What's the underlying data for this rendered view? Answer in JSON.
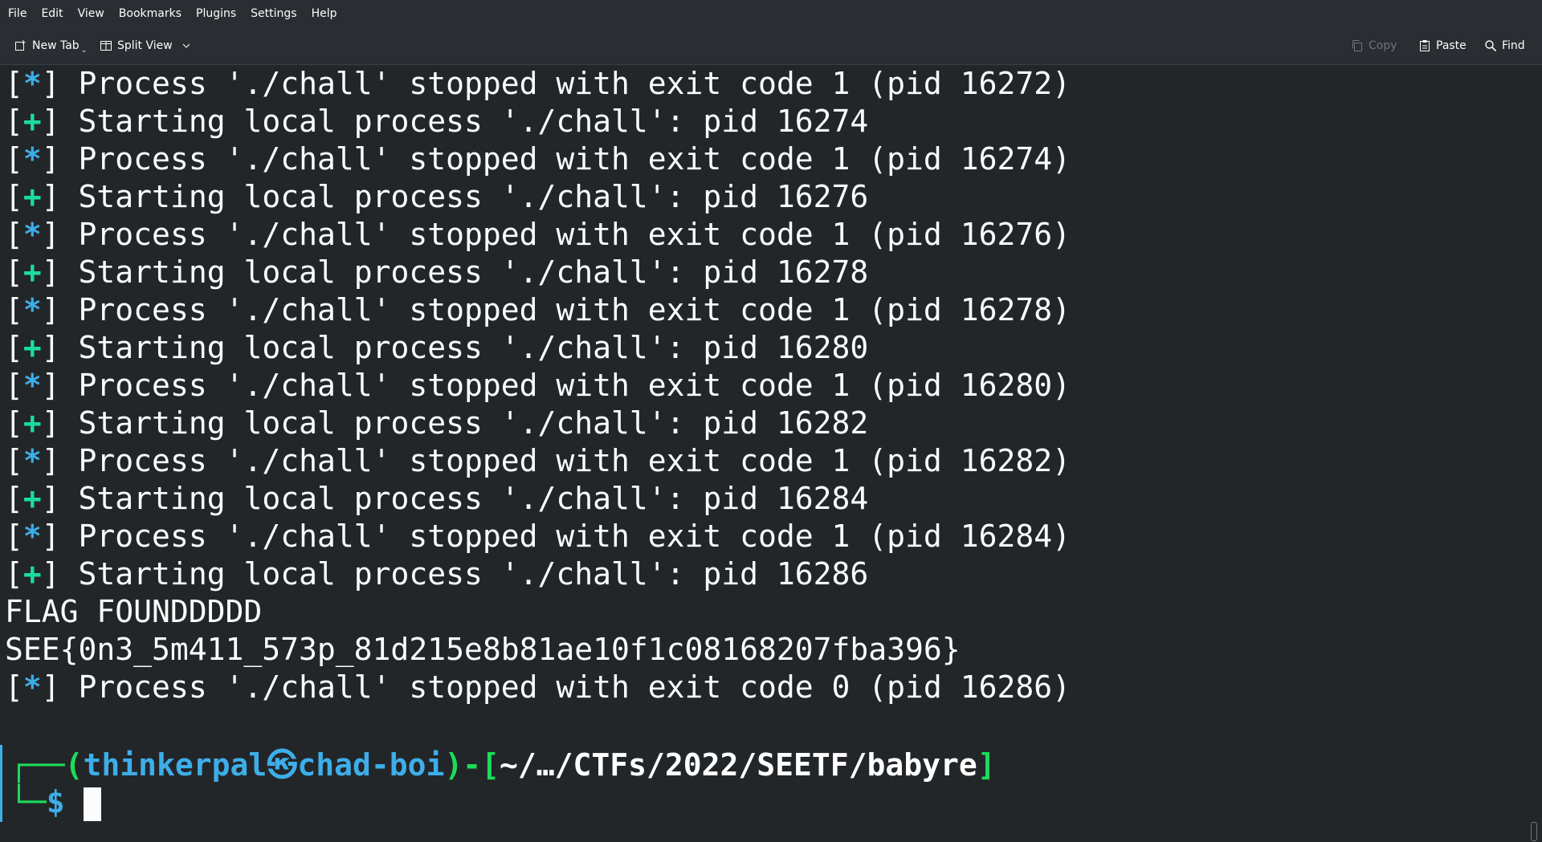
{
  "menu": [
    "File",
    "Edit",
    "View",
    "Bookmarks",
    "Plugins",
    "Settings",
    "Help"
  ],
  "toolbar": {
    "new_tab": "New Tab",
    "split_view": "Split View",
    "copy": "Copy",
    "paste": "Paste",
    "find": "Find"
  },
  "terminal": {
    "lines": [
      {
        "marker": "*",
        "text": " Process './chall' stopped with exit code 1 (pid 16272)"
      },
      {
        "marker": "+",
        "text": " Starting local process './chall': pid 16274"
      },
      {
        "marker": "*",
        "text": " Process './chall' stopped with exit code 1 (pid 16274)"
      },
      {
        "marker": "+",
        "text": " Starting local process './chall': pid 16276"
      },
      {
        "marker": "*",
        "text": " Process './chall' stopped with exit code 1 (pid 16276)"
      },
      {
        "marker": "+",
        "text": " Starting local process './chall': pid 16278"
      },
      {
        "marker": "*",
        "text": " Process './chall' stopped with exit code 1 (pid 16278)"
      },
      {
        "marker": "+",
        "text": " Starting local process './chall': pid 16280"
      },
      {
        "marker": "*",
        "text": " Process './chall' stopped with exit code 1 (pid 16280)"
      },
      {
        "marker": "+",
        "text": " Starting local process './chall': pid 16282"
      },
      {
        "marker": "*",
        "text": " Process './chall' stopped with exit code 1 (pid 16282)"
      },
      {
        "marker": "+",
        "text": " Starting local process './chall': pid 16284"
      },
      {
        "marker": "*",
        "text": " Process './chall' stopped with exit code 1 (pid 16284)"
      },
      {
        "marker": "+",
        "text": " Starting local process './chall': pid 16286"
      },
      {
        "marker": "",
        "text": "FLAG FOUNDDDDD"
      },
      {
        "marker": "",
        "text": "SEE{0n3_5m411_573p_81d215e8b81ae10f1c08168207fba396}"
      },
      {
        "marker": "*",
        "text": " Process './chall' stopped with exit code 0 (pid 16286)"
      }
    ],
    "prompt": {
      "user": "thinkerpal",
      "symbol": "㉿",
      "host": "chad-boi",
      "path": "~/…/CTFs/2022/SEETF/babyre",
      "dollar": "$"
    }
  },
  "colors": {
    "background": "#232629",
    "info_marker": "#3daee9",
    "success_marker": "#1cdc9a",
    "prompt_frame": "#1cdc5a",
    "prompt_user": "#3daee9"
  }
}
